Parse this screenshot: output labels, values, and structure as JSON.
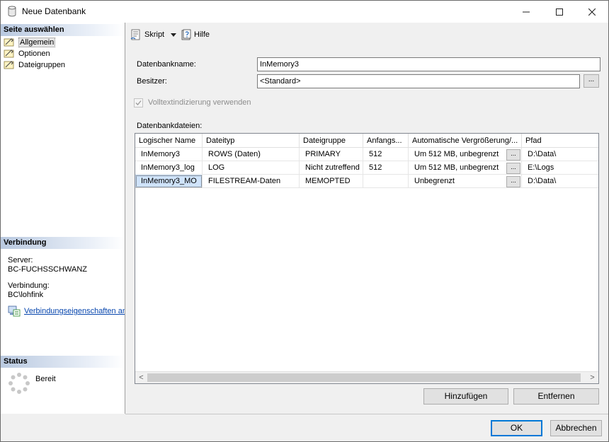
{
  "window": {
    "title": "Neue Datenbank",
    "controls": {
      "minimize": "—",
      "maximize": "☐",
      "close": "✕"
    }
  },
  "sidebar": {
    "pages_header": "Seite auswählen",
    "pages": [
      {
        "label": "Allgemein",
        "selected": true
      },
      {
        "label": "Optionen",
        "selected": false
      },
      {
        "label": "Dateigruppen",
        "selected": false
      }
    ],
    "connection_header": "Verbindung",
    "server_label": "Server:",
    "server_value": "BC-FUCHSSCHWANZ",
    "connection_label": "Verbindung:",
    "connection_value": "BC\\lohfink",
    "properties_link": "Verbindungseigenschaften an",
    "status_header": "Status",
    "status_value": "Bereit"
  },
  "toolbar": {
    "script_label": "Skript",
    "help_label": "Hilfe"
  },
  "form": {
    "db_name_label": "Datenbankname:",
    "db_name_value": "InMemory3",
    "owner_label": "Besitzer:",
    "owner_value": "<Standard>",
    "browse_label": "...",
    "fulltext_label": "Volltextindizierung verwenden",
    "fulltext_checked": true,
    "files_label": "Datenbankdateien:"
  },
  "files_table": {
    "columns": [
      "Logischer Name",
      "Dateityp",
      "Dateigruppe",
      "Anfangs...",
      "Automatische Vergrößerung/...",
      "Pfad"
    ],
    "rows": [
      {
        "name": "InMemory3",
        "type": "ROWS (Daten)",
        "filegroup": "PRIMARY",
        "initial": "512",
        "autogrowth": "Um 512 MB, unbegrenzt",
        "path": "D:\\Data\\"
      },
      {
        "name": "InMemory3_log",
        "type": "LOG",
        "filegroup": "Nicht zutreffend",
        "initial": "512",
        "autogrowth": "Um 512 MB, unbegrenzt",
        "path": "E:\\Logs"
      },
      {
        "name": "InMemory3_MO",
        "type": "FILESTREAM-Daten",
        "filegroup": "MEMOPTED",
        "initial": "",
        "autogrowth": "Unbegrenzt",
        "path": "D:\\Data\\"
      }
    ],
    "cell_button": "...",
    "scroll_left": "<",
    "scroll_right": ">"
  },
  "actions": {
    "add_label": "Hinzufügen",
    "remove_label": "Entfernen",
    "ok_label": "OK",
    "cancel_label": "Abbrechen"
  },
  "colors": {
    "accent": "#0078d7",
    "link": "#0645ad",
    "selection": "#cfe3fb",
    "header_gradient": "#b9c9e0"
  }
}
